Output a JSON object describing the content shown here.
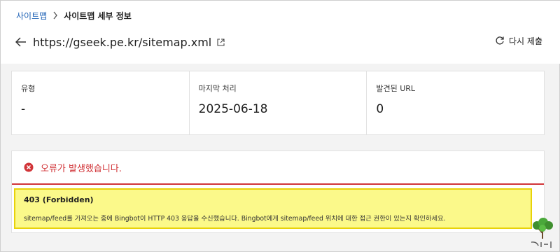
{
  "breadcrumb": {
    "root": "사이트맵",
    "current": "사이트맵 세부 정보"
  },
  "header": {
    "url": "https://gseek.pe.kr/sitemap.xml",
    "resubmit_label": "다시 제출"
  },
  "stats": [
    {
      "label": "유형",
      "value": "-"
    },
    {
      "label": "마지막 처리",
      "value": "2025-06-18"
    },
    {
      "label": "발견된 URL",
      "value": "0"
    }
  ],
  "error": {
    "title": "오류가 발생했습니다.",
    "code": "403 (Forbidden)",
    "message": "sitemap/feed를 가져오는 중에 Bingbot이 HTTP 403 응답을 수신했습니다. Bingbot에게 sitemap/feed 위치에 대한 접근 권한이 있는지 확인하세요."
  },
  "watermark": {
    "text": "느티나무"
  },
  "colors": {
    "link": "#1a5fb4",
    "error": "#d13438",
    "highlight": "#fbf98a",
    "highlight_border": "#e8d20a"
  },
  "icons": [
    "chevron-right-icon",
    "back-arrow-icon",
    "external-link-icon",
    "refresh-icon",
    "error-circle-icon",
    "tree-logo-icon"
  ]
}
